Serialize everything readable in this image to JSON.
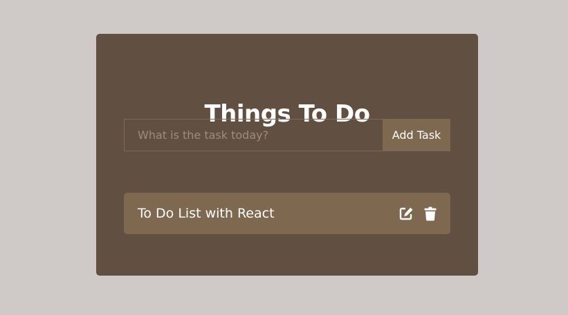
{
  "app": {
    "title": "Things To Do"
  },
  "form": {
    "input_value": "",
    "input_placeholder": "What is the task today?",
    "add_label": "Add Task"
  },
  "tasks": [
    {
      "text": "To Do List with React",
      "actions": [
        "edit-icon",
        "trash-icon"
      ]
    }
  ],
  "colors": {
    "background": "#cfcac7",
    "card": "#614f41",
    "accent": "#7f6850",
    "text": "#ffffff",
    "placeholder": "#9c8d80"
  }
}
